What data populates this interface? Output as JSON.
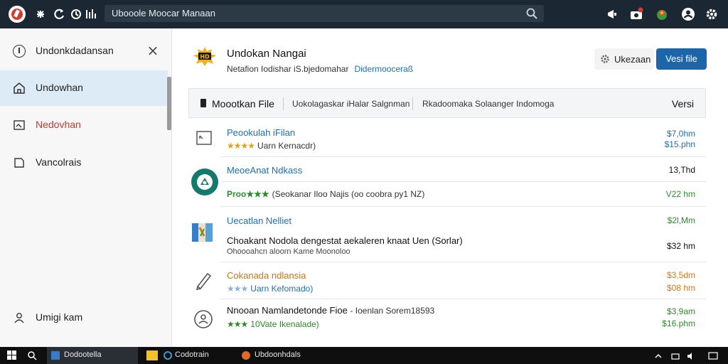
{
  "topbar": {
    "address": "Ubooole Moocar Manaan"
  },
  "sidebar": {
    "header_label": "Undonkdadansan",
    "items": [
      {
        "label": "Undowhan"
      },
      {
        "label": "Nedovhan"
      },
      {
        "label": "Vancolrais"
      }
    ],
    "footer_label": "Umigi kam"
  },
  "page": {
    "title": "Undokan Nangai",
    "subtitle": "Netafion Iodishar iS.bjedomahar",
    "subtitle_link": "Didermooceraß",
    "secondary_button": "Ukezaan",
    "primary_button": "Vesi file"
  },
  "filters": {
    "main": "Moootkan File",
    "items": [
      "Uokolagaskar iHalar Salgnman",
      "Rkadoomaka Solaanger Indomoga"
    ],
    "right": "Versi"
  },
  "rows": [
    {
      "title": "Peookulah iFilan",
      "stars": "★★★★",
      "sub": "Uarn Kernacdr)",
      "price1": "$7,0hm",
      "price2": "$15.phn"
    },
    {
      "title": "MeoeAnat Ndkass",
      "price1": "13,Thd",
      "sub_stars": "Proo★★★",
      "sub": "(Seokanar Iloo Najis (oo coobra py1 NZ)",
      "price2": "V22 hm"
    },
    {
      "title": "Uecatlan Nelliet",
      "price1": "$2l,Mm",
      "sub": "Choakant Nodola dengestat aekaleren knaat Uen (Sorlar)",
      "sub2": "Ohoooahcn aloorn Kame Moonoloo",
      "price2": "$32 hm"
    },
    {
      "title": "Cokanada ndlansia",
      "stars": "★★★",
      "sub": "Uarn Kefomado)",
      "price1": "$3,5dm",
      "price2": "$08 hm"
    },
    {
      "title": "Nnooan Namlandetonde Fioe",
      "title_suffix": "- Ioenlan Sorem18593",
      "stars": "★★★",
      "sub": "10Vate Ikenalade)",
      "price1": "$3,9am",
      "price2": "$16.phm"
    }
  ],
  "taskbar": {
    "items": [
      "Dodootella",
      "Codotrain",
      "Ubdoonhdals"
    ]
  },
  "colors": {
    "topbar": "#1b2833",
    "accent": "#1c65a9",
    "link": "#1f6fb2",
    "green": "#2f8a2f",
    "orange": "#d07a1a"
  }
}
